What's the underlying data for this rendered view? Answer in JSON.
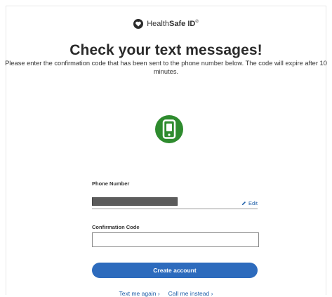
{
  "brand": {
    "name_prefix": "Health",
    "name_bold": "Safe ID",
    "trademark": "®"
  },
  "page": {
    "title": "Check your text messages!",
    "description": "Please enter the confirmation code that has been sent to the phone number below. The code will expire after 10 minutes."
  },
  "icons": {
    "logo": "heart-shield-icon",
    "phone": "smartphone-icon",
    "edit": "pencil-icon"
  },
  "phone_section": {
    "label": "Phone Number",
    "value_redacted": true,
    "edit_label": "Edit"
  },
  "code_section": {
    "label": "Confirmation Code",
    "value": "",
    "placeholder": ""
  },
  "actions": {
    "submit_label": "Create account",
    "text_again_label": "Text me again",
    "call_label": "Call me instead"
  },
  "colors": {
    "primary": "#2d6bbd",
    "link": "#1f5fa8",
    "icon_green": "#2e8b2e"
  }
}
